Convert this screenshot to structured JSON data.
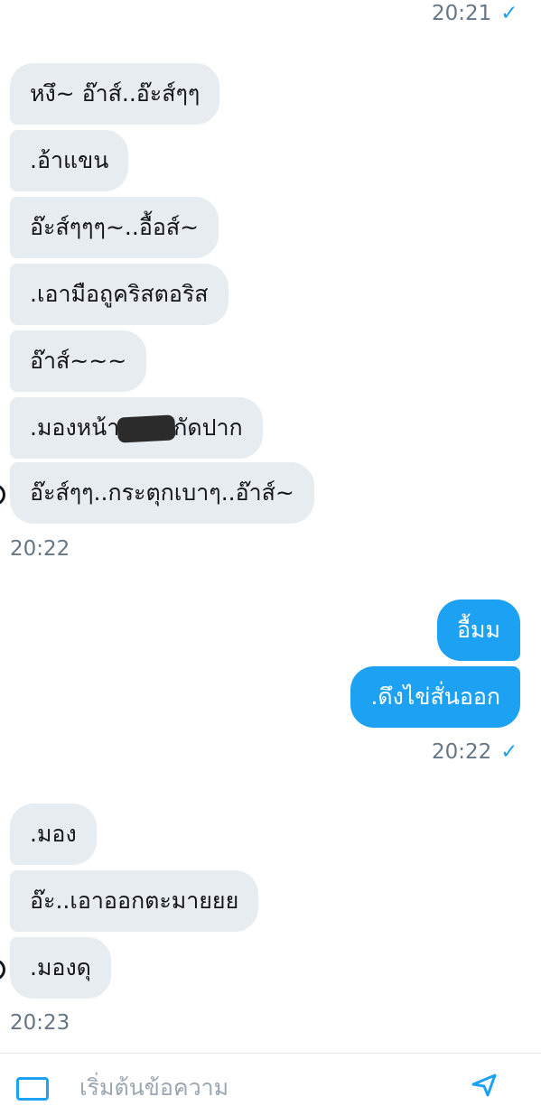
{
  "conversation": {
    "timestamps": {
      "t1": "20:21",
      "t2": "20:22",
      "t3": "20:22",
      "t4": "20:23"
    },
    "messages": [
      {
        "text": "หงึ~ อ๊าส์..อ๊ะส์ๆๆ",
        "from": "them"
      },
      {
        "text": ".อ้าแขน",
        "from": "them"
      },
      {
        "text": "อ๊ะส์ๆๆๆ~..อื้อส์~",
        "from": "them"
      },
      {
        "text": ".เอามือถูคริสตอริส",
        "from": "them"
      },
      {
        "text": "อ๊าส์~~~",
        "from": "them"
      },
      {
        "text_before": ".มองหน้า",
        "text_after": "กัดปาก",
        "from": "them"
      },
      {
        "text": "อ๊ะส์ๆๆ..กระตุกเบาๆ..อ๊าส์~",
        "from": "them"
      },
      {
        "text": "อื้มม",
        "from": "me"
      },
      {
        "text": ".ดึงไข่สั่นออก",
        "from": "me"
      },
      {
        "text": ".มอง",
        "from": "them"
      },
      {
        "text": "อ๊ะ..เอาออกตะมายยย",
        "from": "them"
      },
      {
        "text": ".มองดุ",
        "from": "them"
      }
    ]
  },
  "composer": {
    "placeholder": "เริ่มต้นข้อความ"
  },
  "icons": {
    "read_receipt": "check-icon",
    "media": "image-icon",
    "send": "send-icon"
  },
  "colors": {
    "accent": "#1da1f2",
    "incoming_bubble": "#e6ecf0",
    "timestamp": "#657786"
  }
}
